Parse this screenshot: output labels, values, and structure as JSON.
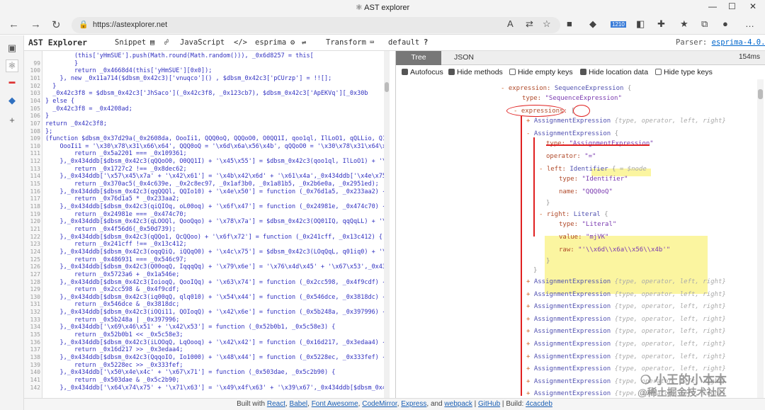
{
  "window": {
    "title": "AST explorer"
  },
  "browser": {
    "url": "https://astexplorer.net",
    "ext_badge": "1210"
  },
  "app": {
    "brand": "AST Explorer",
    "menu": [
      "Snippet",
      "JavaScript",
      "esprima",
      "Transform",
      "default"
    ],
    "parser_label": "Parser:",
    "parser_link": "esprima-4.0.1"
  },
  "editor": {
    "lines": [
      {
        "n": "",
        "code": "        (this['yHmSUE'].push(Math.round(Math.random())), _0x6d8257 = this["
      },
      {
        "n": "99",
        "code": "        }"
      },
      {
        "n": "100",
        "code": "        return _0x4668d4(this['yHmSUE'][0x0]);"
      },
      {
        "n": "101",
        "code": "    }, new _0x11a714($dbsm_0x42c3)['vnuqco']() , $dbsm_0x42c3['pCUrzp'] = !![];"
      },
      {
        "n": "102",
        "code": "  }"
      },
      {
        "n": "103",
        "code": "  _0x42c3f8 = $dbsm_0x42c3['JhSaco'](_0x42c3f8, _0x123cb7), $dbsm_0x42c3['ApEKVq'][_0x30b"
      },
      {
        "n": "104",
        "code": "} else {"
      },
      {
        "n": "105",
        "code": "  _0x42c3f8 = _0x4208ad;"
      },
      {
        "n": "106",
        "code": "}"
      },
      {
        "n": "107",
        "code": "return _0x42c3f8;"
      },
      {
        "n": "108",
        "code": "};"
      },
      {
        "n": "109",
        "code": "(function $dbsm_0x37d29a(_0x2608da, OooIi1, QQQ0oQ, QQQoO0, O0QQ1I, qoo1ql, IlLoO1, qQLLio, Q1Q"
      },
      {
        "n": "110",
        "code": "    OooIi1 = '\\x30\\x78\\x31\\x66\\x64', QQQ0oQ = '\\x6d\\x6a\\x56\\x4b', qQQoO0 = '\\x30\\x78\\x31\\x64\\x6"
      },
      {
        "n": "111",
        "code": "        return _0x5a2201 === _0x109361;"
      },
      {
        "n": "112",
        "code": "    },_0x434ddb[$dbsm_0x42c3(qQQoO0, O0QQ1I) + '\\x45\\x55'] = $dbsm_0x42c3(qoo1ql, IlLoO1) + '\\x"
      },
      {
        "n": "113",
        "code": "        return _0x1727c2 !== _0x8dec62;"
      },
      {
        "n": "114",
        "code": "    },_0x434ddb['\\x57\\x45\\x7a' + '\\x42\\x61'] = '\\x4b\\x42\\x6d' + '\\x61\\x4a',_0x434ddb['\\x4e\\x75\\"
      },
      {
        "n": "115",
        "code": "        return _0x370ac5(_0x4c639e, _0x2c8ec97, _0x1af3b0, _0x1a81b5, _0x2b6e0a, _0x2951ed);"
      },
      {
        "n": "116",
        "code": "    },_0x434ddb[$dbsm_0x42c3(qqQQQl, QQIo10) + '\\x4e\\x50'] = function (_0x76d1a5, _0x233aa2) {"
      },
      {
        "n": "117",
        "code": "        return _0x76d1a5 * _0x233aa2;"
      },
      {
        "n": "118",
        "code": "    },_0x434ddb[$dbsm_0x42c3(qiQIOq, oL00oq) + '\\x6f\\x47'] = function (_0x24981e, _0x474c70) {"
      },
      {
        "n": "119",
        "code": "        return _0x24981e === _0x474c70;"
      },
      {
        "n": "120",
        "code": "    },_0x434ddb[$dbsm_0x42c3(qLOOQl, QooQqo) + '\\x78\\x7a'] = $dbsm_0x42c3(OQ01IQ, qqQqLL) + '\\x"
      },
      {
        "n": "121",
        "code": "        return _0x4f56d6(_0x50d739);"
      },
      {
        "n": "122",
        "code": "    },_0x434ddb[$dbsm_0x42c3(qQQo1, QcQQoo) + '\\x6f\\x72'] = function (_0x241cff, _0x13c412) {"
      },
      {
        "n": "123",
        "code": "        return _0x241cff !== _0x13c412;"
      },
      {
        "n": "124",
        "code": "    },_0x434ddb[$dbsm_0x42c3(oqqQiQ, iQQqO0) + '\\x4c\\x75'] = $dbsm_0x42c3(LOqQqL, q01iq0) + '\\x"
      },
      {
        "n": "125",
        "code": "        return _0x486931 === _0x546c97;"
      },
      {
        "n": "126",
        "code": "    },_0x434ddb[$dbsm_0x42c3(Q00oqQ, IqqqQq) + '\\x79\\x6e'] = '\\x76\\x4d\\x45' + '\\x67\\x53',_0x434"
      },
      {
        "n": "127",
        "code": "        return _0x5723a6 + _0x1a546e;"
      },
      {
        "n": "128",
        "code": "    },_0x434ddb[$dbsm_0x42c3(IoioqQ, QooIQq) + '\\x63\\x74'] = function (_0x2cc598, _0x4f9cdf) {"
      },
      {
        "n": "129",
        "code": "        return _0x2cc598 & _0x4f9cdf;"
      },
      {
        "n": "130",
        "code": "    },_0x434ddb[$dbsm_0x42c3(iq00qQ, qlq010) + '\\x54\\x44'] = function (_0x546dce, _0x3818dc) {"
      },
      {
        "n": "131",
        "code": "        return _0x546dce & _0x3818dc;"
      },
      {
        "n": "132",
        "code": "    },_0x434ddb[$dbsm_0x42c3(iOQi11, QOIoqQ) + '\\x42\\x6e'] = function (_0x5b248a, _0x397996) {"
      },
      {
        "n": "133",
        "code": "        return _0x5b248a | _0x397996;"
      },
      {
        "n": "134",
        "code": "    },_0x434ddb['\\x69\\x46\\x51' + '\\x42\\x53'] = function (_0x52b0b1, _0x5c58e3) {"
      },
      {
        "n": "135",
        "code": "        return _0x52b0b1 << _0x5c58e3;"
      },
      {
        "n": "136",
        "code": "    },_0x434ddb[$dbsm_0x42c3(iLOOqQ, LqOooq) + '\\x42\\x42'] = function (_0x16d217, _0x3edaa4) {"
      },
      {
        "n": "137",
        "code": "        return _0x16d217 >> _0x3edaa4;"
      },
      {
        "n": "138",
        "code": "    },_0x434ddb[$dbsm_0x42c3(QqqoIO, Io1000) + '\\x48\\x44'] = function (_0x5228ec, _0x333fef) {"
      },
      {
        "n": "139",
        "code": "        return _0x5228ec >> _0x333fef;"
      },
      {
        "n": "140",
        "code": "    },_0x434ddb['\\x50\\x4e\\x4c' + '\\x67\\x71'] = function (_0x503dae, _0x5c2b90) {"
      },
      {
        "n": "141",
        "code": "        return _0x503dae & _0x5c2b90;"
      },
      {
        "n": "142",
        "code": "    },_0x434ddb['\\x64\\x74\\x75' + '\\x71\\x63'] = '\\x49\\x4f\\x63' + '\\x39\\x67',_0x434ddb[$dbsm_0x42"
      }
    ]
  },
  "output": {
    "tabs": [
      "Tree",
      "JSON"
    ],
    "timing": "154ms",
    "options": [
      {
        "label": "Autofocus",
        "checked": true
      },
      {
        "label": "Hide methods",
        "checked": true
      },
      {
        "label": "Hide empty keys",
        "checked": false
      },
      {
        "label": "Hide location data",
        "checked": true
      },
      {
        "label": "Hide type keys",
        "checked": false
      }
    ],
    "tree": {
      "expression_key": "expression:",
      "expression_type": "SequenceExpression",
      "type_key": "type:",
      "seq_type_val": "\"SequenceExpression\"",
      "expressions_key": "expressions:",
      "assign_name": "AssignmentExpression",
      "assign_props": "{type, operator, left, right}",
      "assign_type_val": "\"AssignmentExpression\"",
      "operator_key": "operator:",
      "operator_val": "\"=\"",
      "left_key": "left:",
      "identifier_name": "Identifier",
      "node_tag": "= $node",
      "identifier_type_val": "\"Identifier\"",
      "name_key": "name:",
      "name_val": "\"QQQ0oQ\"",
      "right_key": "right:",
      "literal_name": "Literal",
      "literal_type_val": "\"Literal\"",
      "value_key": "value:",
      "value_val": "\"mjVK\"",
      "raw_key": "raw:",
      "raw_val": "\"'\\\\x6d\\\\x6a\\\\x56\\\\x4b'\""
    }
  },
  "footer": {
    "built_with": "Built with",
    "links": [
      "React",
      "Babel",
      "Font Awesome",
      "CodeMirror",
      "Express",
      "webpack",
      "GitHub",
      "4cacdeb"
    ],
    "and_text": "and",
    "build_label": "Build:"
  },
  "watermark": {
    "line1": "小王的小本本",
    "line2": "@稀土掘金技术社区"
  }
}
